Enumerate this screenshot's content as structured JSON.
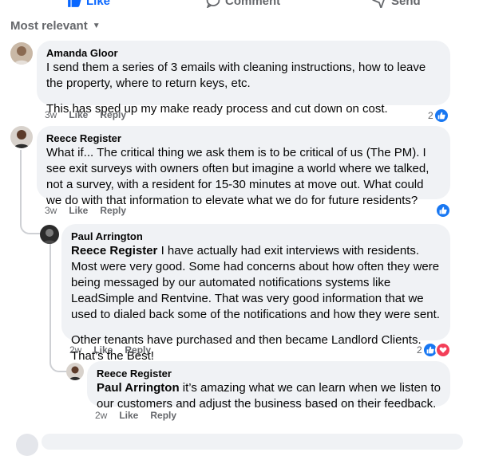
{
  "actions": {
    "like": "Like",
    "comment": "Comment",
    "send": "Send"
  },
  "sort_label": "Most relevant",
  "comments": [
    {
      "author": "Amanda Gloor",
      "paragraphs": [
        "I send them a series of 3 emails with cleaning instructions, how to leave the property, where to return keys, etc.",
        "This has sped up my make ready process and cut down on cost."
      ],
      "time": "3w",
      "like": "Like",
      "reply": "Reply",
      "reaction_count": "2"
    },
    {
      "author": "Reece Register",
      "paragraphs": [
        "What if... The critical thing we ask them is to be critical of us (The PM). I see exit surveys with owners often but imagine a world where we talked, not a survey, with a resident for 15-30 minutes at move out. What could we do with that information to elevate what we do for future residents?"
      ],
      "time": "3w",
      "like": "Like",
      "reply": "Reply",
      "reaction_count": ""
    },
    {
      "author": "Paul Arrington",
      "mention": "Reece Register",
      "paragraphs": [
        " I have actually had exit interviews with residents. Most were very good. Some had concerns about how often they were being messaged by our automated notifications systems like LeadSimple and Rentvine. That was very good information that we used to dialed back some of the notifications and how they were sent.",
        "Other tenants have purchased and then became Landlord Clients. That’s the Best!"
      ],
      "time": "2w",
      "like": "Like",
      "reply": "Reply",
      "reaction_count": "2"
    },
    {
      "author": "Reece Register",
      "mention": "Paul Arrington",
      "paragraphs": [
        " it’s amazing what we can learn when we listen to our customers and adjust the business based on their feedback."
      ],
      "time": "2w",
      "like": "Like",
      "reply": "Reply"
    }
  ],
  "colors": {
    "accent": "#1877f2",
    "love": "#f33e58",
    "bubble": "#f0f2f5",
    "muted": "#65676b"
  }
}
